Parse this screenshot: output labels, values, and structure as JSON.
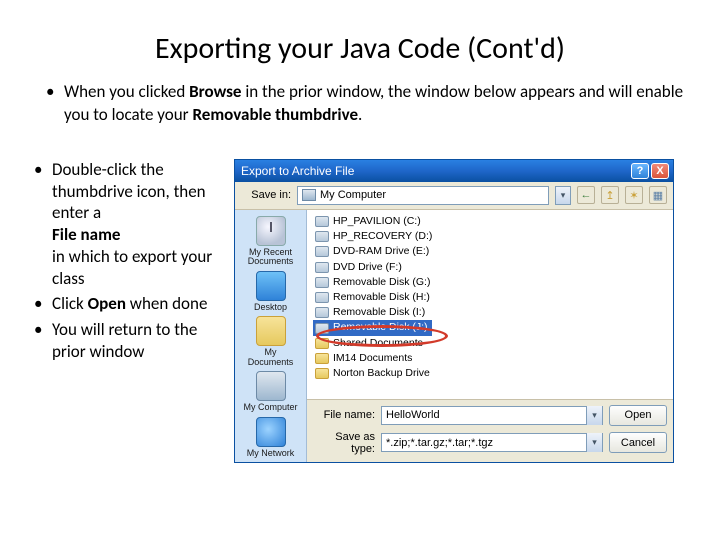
{
  "title": "Exporting your Java Code (Cont'd)",
  "top_bullet": {
    "part1": "When you clicked ",
    "bold1": "Browse",
    "part2": " in the prior window, the window below appears and will enable you to locate your ",
    "bold2": "Removable thumbdrive",
    "part3": "."
  },
  "left_bullets": {
    "b1a": "Double-click the thumbdrive icon, then enter a",
    "b1_bold": "File name",
    "b1b": "in which to export your class",
    "b2a": "Click ",
    "b2_bold": "Open",
    "b2b": " when done",
    "b3": "You will return to the prior window"
  },
  "dialog": {
    "title": "Export to Archive File",
    "help": "?",
    "close": "X",
    "savein_label": "Save in:",
    "savein_value": "My Computer",
    "back_char": "←",
    "up_char": "↥",
    "new_char": "✶",
    "views_char": "▦",
    "dd_char": "▾",
    "places": {
      "recent": "My Recent Documents",
      "desktop": "Desktop",
      "docs": "My Documents",
      "mycomp": "My Computer",
      "net": "My Network"
    },
    "items": [
      "HP_PAVILION (C:)",
      "HP_RECOVERY (D:)",
      "DVD-RAM Drive (E:)",
      "DVD Drive (F:)",
      "Removable Disk (G:)",
      "Removable Disk (H:)",
      "Removable Disk (I:)",
      "Removable Disk (J:)",
      "Shared Documents",
      "IM14 Documents",
      "Norton Backup Drive"
    ],
    "selected_index": 7,
    "filename_label": "File name:",
    "filename_value": "HelloWorld",
    "saveas_label": "Save as type:",
    "saveas_value": "*.zip;*.tar.gz;*.tar;*.tgz",
    "open_btn": "Open",
    "cancel_btn": "Cancel"
  }
}
